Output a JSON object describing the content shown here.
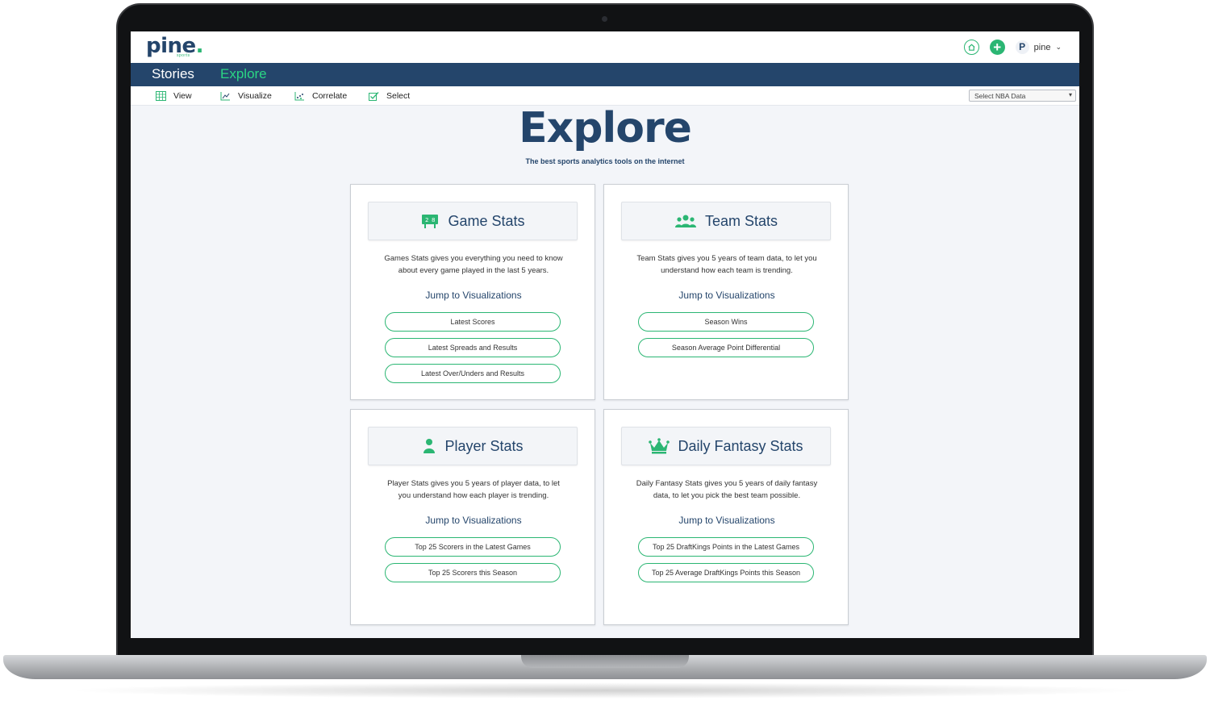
{
  "app": {
    "logo_text": "pine",
    "logo_dot": ".",
    "logo_sub": "sports",
    "user_name": "pine",
    "avatar_letter": "P"
  },
  "nav": {
    "items": [
      {
        "label": "Stories",
        "active": false
      },
      {
        "label": "Explore",
        "active": true
      }
    ]
  },
  "subnav": {
    "items": [
      {
        "label": "View",
        "icon": "table-icon"
      },
      {
        "label": "Visualize",
        "icon": "chart-icon"
      },
      {
        "label": "Correlate",
        "icon": "scatter-icon"
      },
      {
        "label": "Select",
        "icon": "check-icon"
      }
    ],
    "select_value": "Select NBA Data"
  },
  "hero": {
    "title": "Explore",
    "subtitle": "The best sports analytics tools on the internet"
  },
  "cards": [
    {
      "title": "Game Stats",
      "icon": "scoreboard-icon",
      "desc_line1": "Games Stats gives you everything you need to know",
      "desc_line2": "about every game played in the last 5 years.",
      "jump": "Jump to Visualizations",
      "buttons": [
        "Latest Scores",
        "Latest Spreads and Results",
        "Latest Over/Unders and Results"
      ]
    },
    {
      "title": "Team Stats",
      "icon": "team-icon",
      "desc_line1": "Team Stats gives you 5 years of team data, to let you",
      "desc_line2": "understand how each team is trending.",
      "jump": "Jump to Visualizations",
      "buttons": [
        "Season Wins",
        "Season Average Point Differential"
      ]
    },
    {
      "title": "Player Stats",
      "icon": "person-icon",
      "desc_line1": "Player Stats gives you 5 years of player data, to let",
      "desc_line2": "you understand how each player is trending.",
      "jump": "Jump to Visualizations",
      "buttons": [
        "Top 25 Scorers in the Latest Games",
        "Top 25 Scorers this Season"
      ]
    },
    {
      "title": "Daily Fantasy Stats",
      "icon": "crown-icon",
      "desc_line1": "Daily Fantasy Stats gives you 5 years of daily fantasy",
      "desc_line2": "data, to let you pick the best team possible.",
      "jump": "Jump to Visualizations",
      "buttons": [
        "Top 25 DraftKings Points in the Latest Games",
        "Top 25 Average DraftKings Points this Season"
      ]
    }
  ],
  "colors": {
    "brand_navy": "#24456b",
    "accent_green": "#2bb673",
    "nav_active": "#2bd684",
    "background": "#f3f5f9"
  }
}
